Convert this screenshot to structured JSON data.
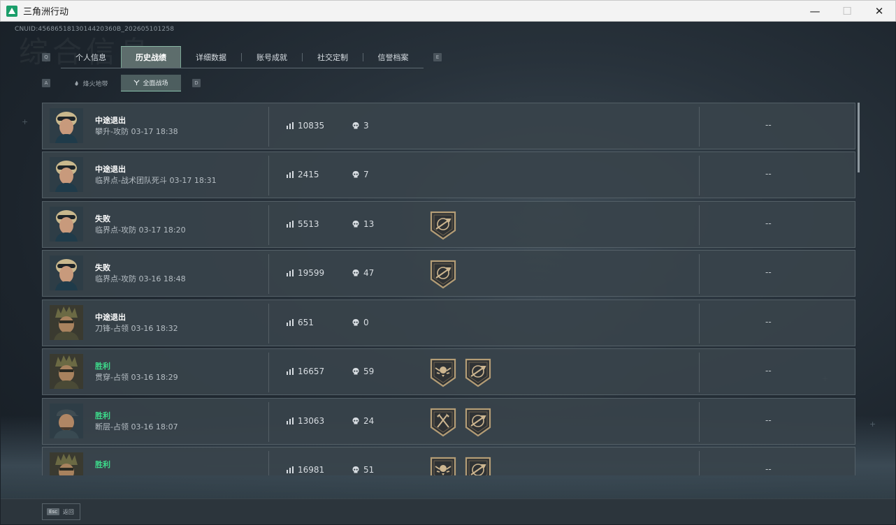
{
  "window": {
    "title": "三角洲行动",
    "minimize": "—",
    "maximize": "☐",
    "close": "✕"
  },
  "uid": "CNUID:4568651813014420360B_202605101258",
  "watermark": "综合信息",
  "tabs": {
    "prev_key": "Q",
    "next_key": "E",
    "items": [
      {
        "label": "个人信息",
        "active": false
      },
      {
        "label": "历史战绩",
        "active": true
      },
      {
        "label": "详细数据",
        "active": false
      },
      {
        "label": "账号成就",
        "active": false
      },
      {
        "label": "社交定制",
        "active": false
      },
      {
        "label": "信誉档案",
        "active": false
      }
    ]
  },
  "subtabs": {
    "prev_key": "A",
    "next_key": "D",
    "items": [
      {
        "label": "烽火地带",
        "icon": "flame-icon",
        "active": false
      },
      {
        "label": "全面战场",
        "icon": "crosshair-icon",
        "active": true
      }
    ]
  },
  "matches": [
    {
      "result": "中途退出",
      "detail": "攀升-攻防 03-17 18:38",
      "score": "10835",
      "kills": "3",
      "badges": [],
      "extra": "--",
      "avatar": "female-operator-avatar",
      "win": false
    },
    {
      "result": "中途退出",
      "detail": "临界点-战术团队死斗 03-17 18:31",
      "score": "2415",
      "kills": "7",
      "badges": [],
      "extra": "--",
      "avatar": "female-operator-avatar",
      "win": false
    },
    {
      "result": "失败",
      "detail": "临界点-攻防 03-17 18:20",
      "score": "5513",
      "kills": "13",
      "badges": [
        "rifle-badge-icon"
      ],
      "extra": "--",
      "avatar": "female-operator-avatar",
      "win": false
    },
    {
      "result": "失败",
      "detail": "临界点-攻防 03-16 18:48",
      "score": "19599",
      "kills": "47",
      "badges": [
        "rifle-badge-icon"
      ],
      "extra": "--",
      "avatar": "female-operator-avatar",
      "win": false
    },
    {
      "result": "中途退出",
      "detail": "刀锋-占领 03-16 18:32",
      "score": "651",
      "kills": "0",
      "badges": [],
      "extra": "--",
      "avatar": "helmet-operator-avatar",
      "win": false
    },
    {
      "result": "胜利",
      "detail": "贯穿-占领 03-16 18:29",
      "score": "16657",
      "kills": "59",
      "badges": [
        "skull-wings-badge-icon",
        "rifle-badge-icon"
      ],
      "extra": "--",
      "avatar": "helmet-operator-avatar",
      "win": true
    },
    {
      "result": "胜利",
      "detail": "断层-占领 03-16 18:07",
      "score": "13063",
      "kills": "24",
      "badges": [
        "axes-badge-icon",
        "rifle-badge-icon"
      ],
      "extra": "--",
      "avatar": "cap-operator-avatar",
      "win": true
    },
    {
      "result": "胜利",
      "detail": "",
      "score": "16981",
      "kills": "51",
      "badges": [
        "skull-wings-badge-icon",
        "rifle-badge-icon"
      ],
      "extra": "--",
      "avatar": "helmet-operator-avatar",
      "win": true
    }
  ],
  "bottom": {
    "esc_key": "Esc",
    "esc_label": "返回"
  },
  "colors": {
    "win": "#3ddc8b",
    "accent_tab": "#5d6d6c",
    "row_bg": "#38434b"
  }
}
